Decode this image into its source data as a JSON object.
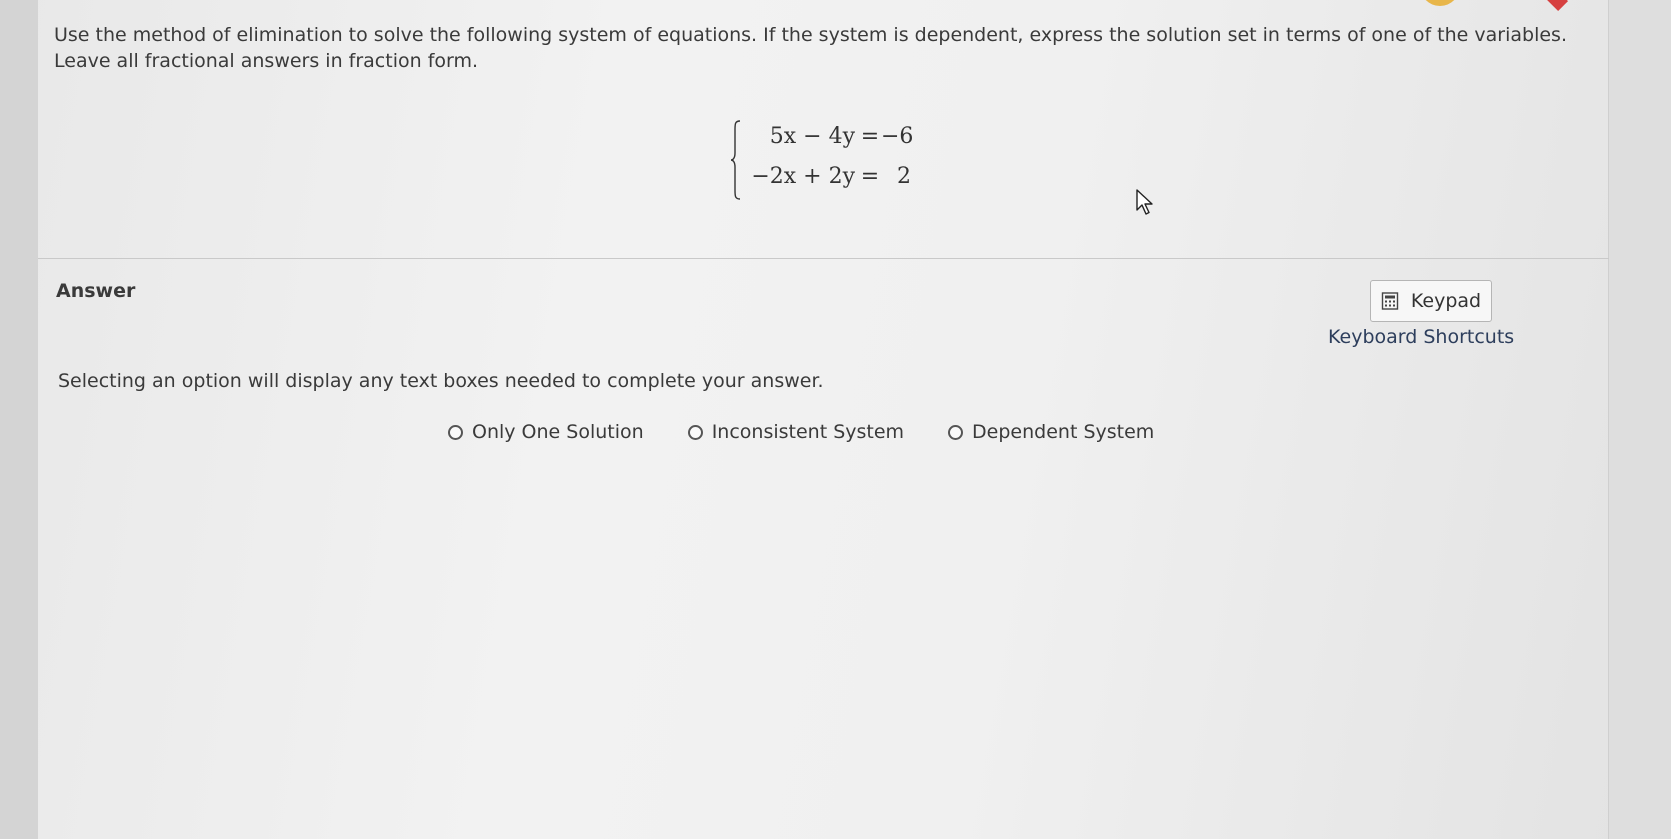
{
  "question": {
    "text": "Use the method of elimination to solve the following system of equations. If the system is dependent, express the solution set in terms of one of the variables. Leave all fractional answers in fraction form."
  },
  "system": {
    "equations": [
      {
        "lhs": "5x − 4y",
        "eq": "=",
        "rhs": "−6"
      },
      {
        "lhs": "−2x + 2y",
        "eq": "=",
        "rhs": "2"
      }
    ]
  },
  "answer": {
    "label": "Answer",
    "keypad_label": "Keypad",
    "keypad_icon": "calculator-icon",
    "shortcuts_label": "Keyboard Shortcuts",
    "instruction": "Selecting an option will display any text boxes needed to complete your answer.",
    "options": [
      {
        "label": "Only One Solution"
      },
      {
        "label": "Inconsistent System"
      },
      {
        "label": "Dependent System"
      }
    ]
  },
  "colors": {
    "link": "#2d3e5c",
    "badge_orange": "#e8b64a",
    "badge_red": "#d64040"
  }
}
